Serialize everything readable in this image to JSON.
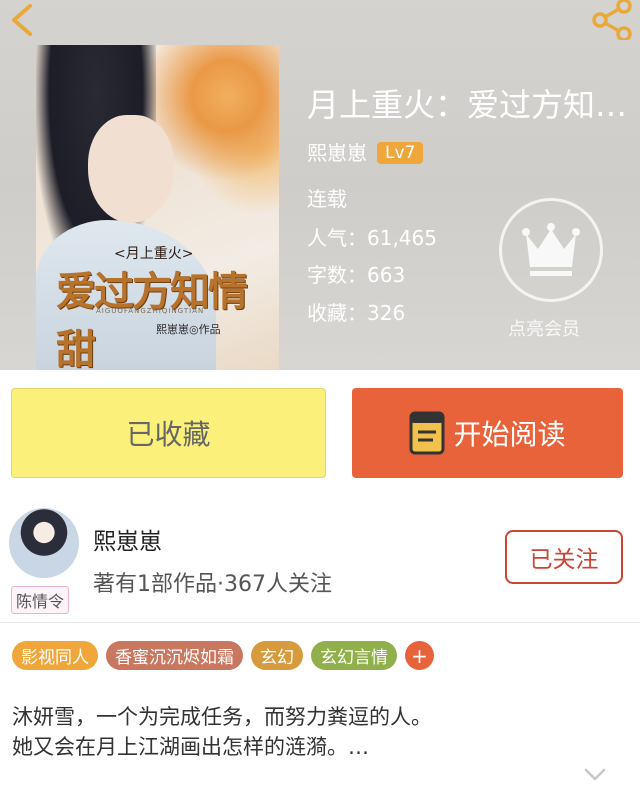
{
  "book": {
    "title": "月上重火：爱过方知…",
    "author": "熙崽崽",
    "level": "Lv7",
    "status": "连载",
    "popularity": "人气：61,465",
    "word_count": "字数：663",
    "favorites": "收藏：326"
  },
  "cover": {
    "subtitle": "<月上重火>",
    "main_text": "爱过方知情甜",
    "pinyin": "AIGUOFANGZHIQINGTIAN",
    "author_credit": "熙崽崽◎作品"
  },
  "vip": {
    "label": "点亮会员",
    "icon": "crown-icon"
  },
  "actions": {
    "favorited_label": "已收藏",
    "read_label": "开始阅读",
    "read_icon": "book-icon"
  },
  "author_card": {
    "name": "熙崽崽",
    "stats": "著有1部作品·367人关注",
    "avatar_tag": "陈情令",
    "follow_label": "已关注"
  },
  "tags": [
    {
      "label": "影视同人",
      "color": "#f0a63a"
    },
    {
      "label": "香蜜沉沉烬如霜",
      "color": "#c9775f"
    },
    {
      "label": "玄幻",
      "color": "#d79a3c"
    },
    {
      "label": "玄幻言情",
      "color": "#8fb04a"
    },
    {
      "label": "+",
      "color": "#e8623a"
    }
  ],
  "description": {
    "line1": "沐妍雪，一个为完成任务，而努力粪逗的人。",
    "line2": "她又会在月上江湖画出怎样的涟漪。…"
  },
  "colors": {
    "accent_orange": "#e8623a",
    "favorite_yellow": "#fbf17a",
    "follow_red": "#c84633"
  }
}
